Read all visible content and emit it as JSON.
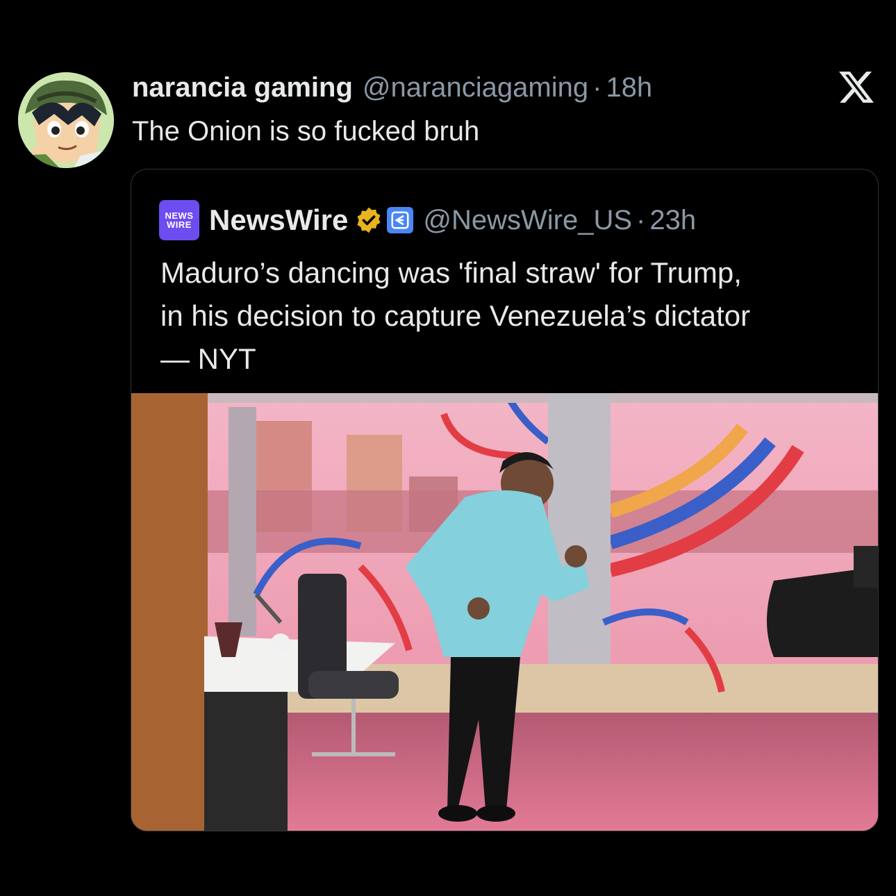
{
  "tweet": {
    "display_name": "narancia gaming",
    "handle": "@naranciagaming",
    "separator": "·",
    "time": "18h",
    "text": "The Onion is so fucked bruh",
    "avatar_icon": "anime-boy-avatar"
  },
  "platform_logo": "x-logo",
  "quoted": {
    "avatar_line1": "NEWS",
    "avatar_line2": "WIRE",
    "display_name": "NewsWire",
    "verified_icon": "verified-badge-icon",
    "affiliate_icon": "affiliate-badge-icon",
    "handle": "@NewsWire_US",
    "separator": "·",
    "time": "23h",
    "text_lines": [
      "Maduro’s dancing was 'final straw' for Trump,",
      "in his decision to capture Venezuela’s dictator",
      "— NYT"
    ],
    "image": "man-dancing-in-radio-studio"
  },
  "colors": {
    "background": "#000000",
    "text": "#e7e9ea",
    "muted": "#8b98a5",
    "verified": "#e8b41e",
    "affiliate": "#4a86f7",
    "newswire": "#6d4cf0"
  }
}
